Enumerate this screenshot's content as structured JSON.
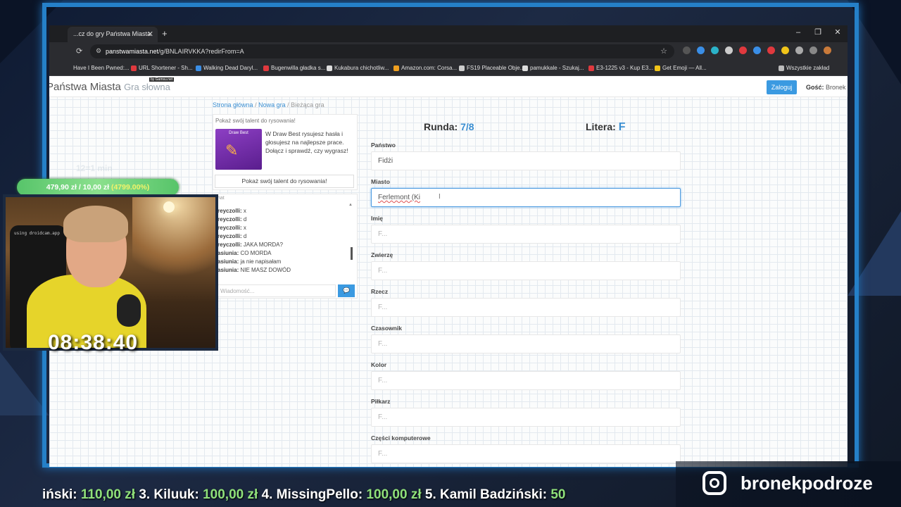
{
  "browser": {
    "tab_title": "...cz do gry Państwa Miasta",
    "new_tab": "+",
    "url_domain": "panstwamiasta.net",
    "url_path": "/g/BNLAIRVKKA?redirFrom=A",
    "bookmarks": [
      "Have I Been Pwned:...",
      "URL Shortener - Sh...",
      "Walking Dead Daryl...",
      "Bugenwilla gładka s...",
      "Kukabura chichotliw...",
      "Amazon.com: Corsa...",
      "FS19 Placeable Obje...",
      "pamukkale - Szukaj...",
      "E3-1225 v3 - Kup E3...",
      "Get Emoji — All...",
      "Wszystkie zakład"
    ]
  },
  "site": {
    "brand": "Państwa Miasta",
    "brand_sub": "Gra słowna",
    "brand_by": "by Gamsu.net",
    "login_label": "Zaloguj",
    "guest_prefix": "Gość:",
    "guest_name": "Bronek"
  },
  "breadcrumb": {
    "home": "Strona główna",
    "new_game": "Nowa gra",
    "current": "Bieżąca gra"
  },
  "promo": {
    "title": "Pokaż swój talent do rysowania!",
    "img_label": "Draw Best",
    "text": "W Draw Best rysujesz hasła i głosujesz na najlepsze prace. Dołącz i sprawdź, czy wygrasz!",
    "button": "Pokaż swój talent do rysowania!"
  },
  "chat": {
    "header": "hat",
    "messages": [
      {
        "user": "reyczolli:",
        "text": " x"
      },
      {
        "user": "reyczolli:",
        "text": " d"
      },
      {
        "user": "reyczolli:",
        "text": " x"
      },
      {
        "user": "reyczolli:",
        "text": " d"
      },
      {
        "user": "reyczolli:",
        "text": " JAKA MORDA?"
      },
      {
        "user": "asiunia:",
        "text": " CO MORDA"
      },
      {
        "user": "asiunia:",
        "text": " ja nie napisałam"
      },
      {
        "user": "asiunia:",
        "text": " NIE MASZ DOWÓD"
      }
    ],
    "input_placeholder": "Wiadomość..."
  },
  "game": {
    "round_label": "Runda:",
    "round_value": "7/8",
    "letter_label": "Litera:",
    "letter_value": "F",
    "fields": [
      {
        "label": "Państwo",
        "value": "Fidżi",
        "placeholder": false
      },
      {
        "label": "Miasto",
        "value": "Ferlemont (Ki",
        "placeholder": false,
        "active": true
      },
      {
        "label": "Imię",
        "value": "F...",
        "placeholder": true
      },
      {
        "label": "Zwierzę",
        "value": "F...",
        "placeholder": true
      },
      {
        "label": "Rzecz",
        "value": "F...",
        "placeholder": true
      },
      {
        "label": "Czasownik",
        "value": "F...",
        "placeholder": true
      },
      {
        "label": "Kolor",
        "value": "F...",
        "placeholder": true
      },
      {
        "label": "Piłkarz",
        "value": "F...",
        "placeholder": true
      },
      {
        "label": "Części komputerowe",
        "value": "F...",
        "placeholder": true
      }
    ]
  },
  "stream": {
    "donation_amount": "479,90 zł / 10,00 zł",
    "donation_pct": "(4799.00%)",
    "ghost_timer": "12=1 min",
    "webcam_text": "using droidcam.app",
    "timer": "08:38:40",
    "ticker": [
      {
        "name": "iński:",
        "amount": " 110,00 zł "
      },
      {
        "name": "3. Kiluuk:",
        "amount": " 100,00 zł "
      },
      {
        "name": "4. MissingPello:",
        "amount": " 100,00 zł "
      },
      {
        "name": "5. Kamil Badziński:",
        "amount": " 50"
      }
    ],
    "instagram": "bronekpodroze"
  },
  "colors": {
    "accent": "#3b9ae1",
    "overlay_blue": "#2a8bd6",
    "donation_green": "#57c46a"
  }
}
